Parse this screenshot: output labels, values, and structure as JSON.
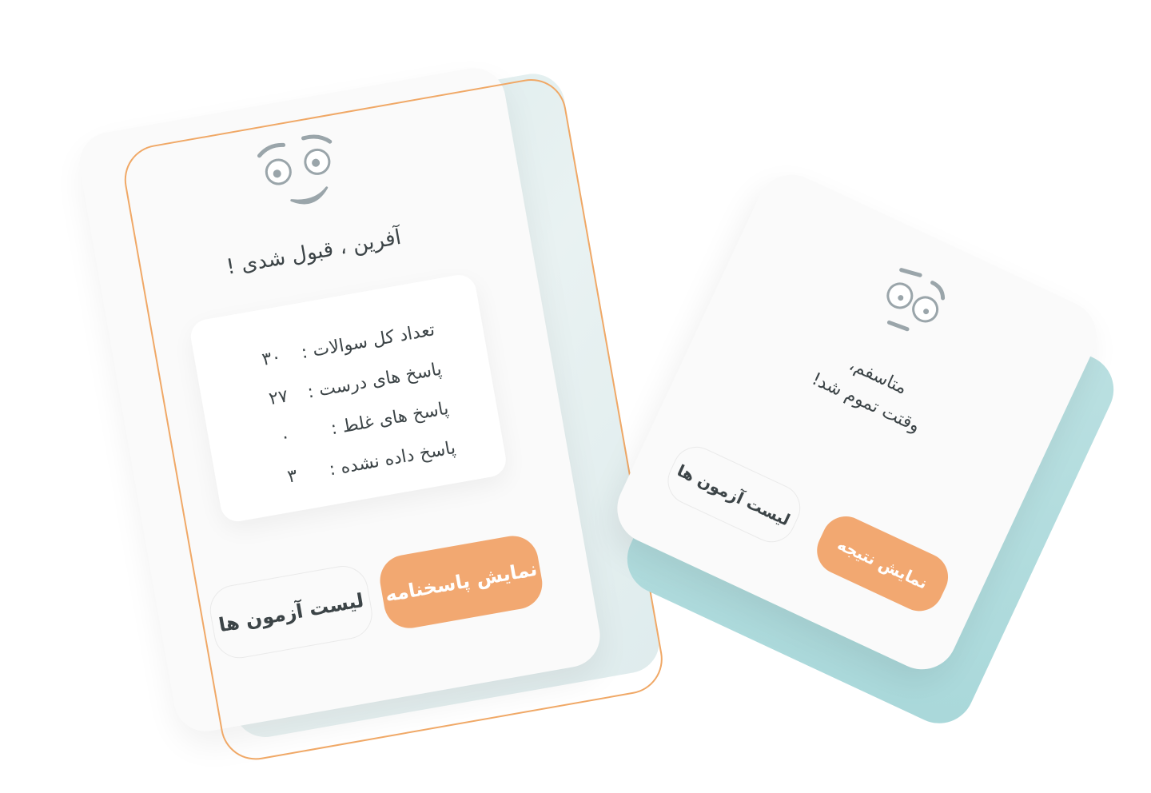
{
  "success_card": {
    "title": "آفرین ، قبول شدی !",
    "stats": [
      {
        "label": "تعداد کل سوالات :",
        "value": "۳۰"
      },
      {
        "label": "پاسخ های درست :",
        "value": "۲۷"
      },
      {
        "label": "پاسخ های غلط :",
        "value": "۰"
      },
      {
        "label": "پاسخ داده نشده :",
        "value": "۳"
      }
    ],
    "primary_button": "نمایش پاسخنامه",
    "secondary_button": "لیست آزمون ها",
    "face_icon": "happy-face-icon"
  },
  "timeout_card": {
    "line1": "متاسفم،",
    "line2": "وقتت تموم شد!",
    "primary_button": "نمایش نتیجه",
    "secondary_button": "لیست آزمون ها",
    "face_icon": "worried-face-icon"
  },
  "colors": {
    "accent": "#f2a871",
    "outline": "#f0a866",
    "teal_shadow": "#a9d8da",
    "text": "#3c4447",
    "face": "#9aa5aa"
  }
}
